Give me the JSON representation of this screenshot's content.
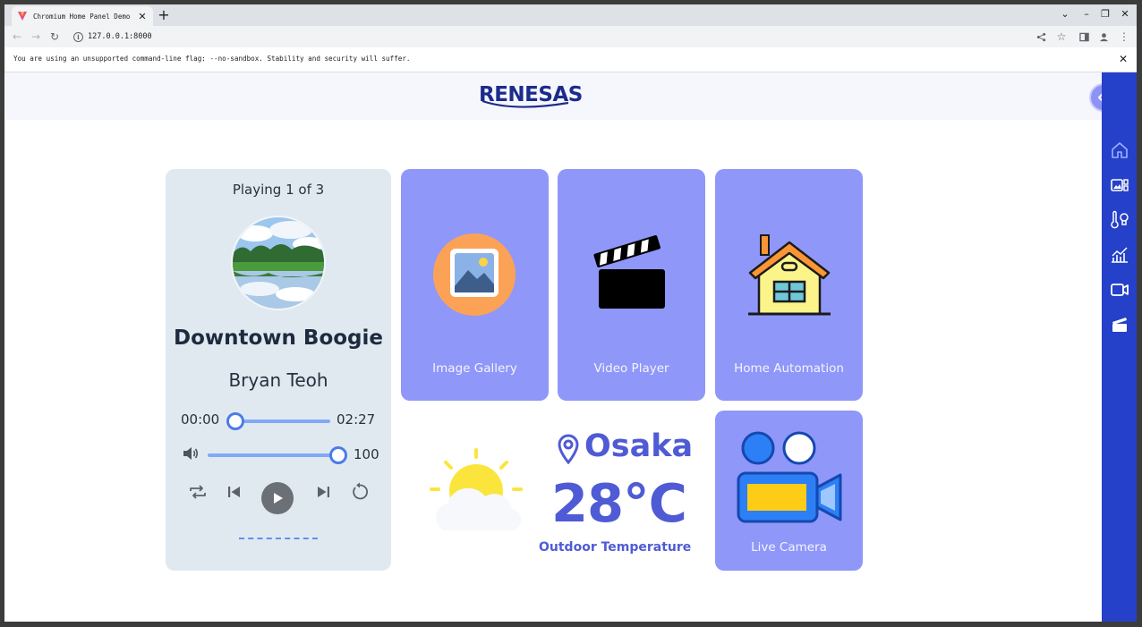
{
  "browser": {
    "tab_title": "Chromium Home Panel Demo",
    "url": "127.0.0.1:8000",
    "infobar_message": "You are using an unsupported command-line flag: --no-sandbox. Stability and security will suffer."
  },
  "header": {
    "logo_text": "RENESAS"
  },
  "music_player": {
    "playlist_status": "Playing 1 of 3",
    "song_title": "Downtown Boogie",
    "artist": "Bryan Teoh",
    "elapsed": "00:00",
    "duration": "02:27",
    "progress_fraction": 0.0,
    "volume_value": "100",
    "volume_fraction": 1.0
  },
  "apps": [
    {
      "label": "Image Gallery",
      "icon": "image-gallery-icon"
    },
    {
      "label": "Video Player",
      "icon": "clapperboard-icon"
    },
    {
      "label": "Home Automation",
      "icon": "house-icon"
    },
    {
      "label": "Live Camera",
      "icon": "video-camera-icon"
    }
  ],
  "weather": {
    "city": "Osaka",
    "temperature": "28°C",
    "caption": "Outdoor Temperature"
  },
  "sidebar": {
    "items": [
      {
        "icon": "home-icon"
      },
      {
        "icon": "gallery-panel-icon"
      },
      {
        "icon": "thermometer-bulb-icon"
      },
      {
        "icon": "chart-icon"
      },
      {
        "icon": "video-camera-icon"
      },
      {
        "icon": "clapperboard-icon"
      }
    ]
  },
  "colors": {
    "tile": "#8f97f9",
    "sidebar": "#2540c9",
    "accent": "#4f5bd5",
    "music_card": "#e1e9f0"
  }
}
